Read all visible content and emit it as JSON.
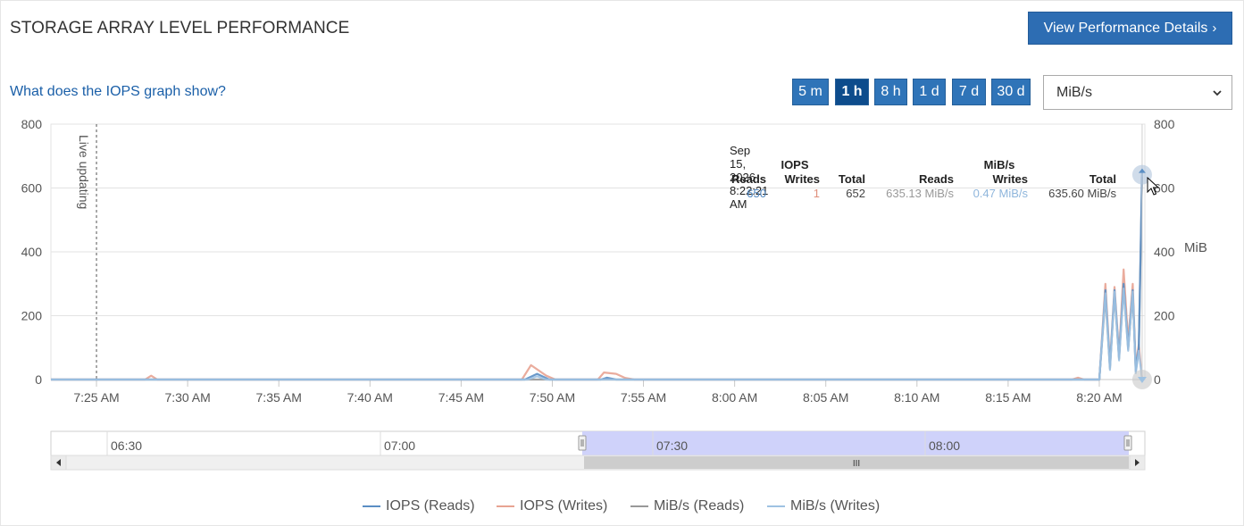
{
  "header": {
    "title": "STORAGE ARRAY LEVEL PERFORMANCE",
    "details_button": "View Performance Details",
    "details_chevron": "›"
  },
  "help_link": "What does the IOPS graph show?",
  "range_buttons": [
    "5 m",
    "1 h",
    "8 h",
    "1 d",
    "7 d",
    "30 d"
  ],
  "active_range": "1 h",
  "unit_select": {
    "value": "MiB/s"
  },
  "live_label": "Live updating",
  "tooltip": {
    "date": "Sep 15, 2026 8:22:21 AM",
    "iops_group": "IOPS",
    "mibs_group": "MiB/s",
    "headers": [
      "Reads",
      "Writes",
      "Total",
      "Reads",
      "Writes",
      "Total"
    ],
    "values": [
      "650",
      "1",
      "652",
      "635.13 MiB/s",
      "0.47 MiB/s",
      "635.60 MiB/s"
    ]
  },
  "right_axis_title": "MiB",
  "navigator": {
    "labels": [
      "06:30",
      "07:00",
      "07:30",
      "08:00"
    ],
    "scroll_grip": "III"
  },
  "legend": [
    {
      "name": "IOPS (Reads)",
      "color": "#5b8ec4"
    },
    {
      "name": "IOPS (Writes)",
      "color": "#e8a392"
    },
    {
      "name": "MiB/s (Reads)",
      "color": "#999999"
    },
    {
      "name": "MiB/s (Writes)",
      "color": "#9fc2e2"
    }
  ],
  "colors": {
    "accent": "#2d6db3",
    "active_range": "#0d4c8c",
    "navigator_selection": "#ccd0fa"
  },
  "chart_data": {
    "type": "line",
    "x_unit": "time",
    "x_ticks": [
      "7:25 AM",
      "7:30 AM",
      "7:35 AM",
      "7:40 AM",
      "7:45 AM",
      "7:50 AM",
      "7:55 AM",
      "8:00 AM",
      "8:05 AM",
      "8:10 AM",
      "8:15 AM",
      "8:20 AM"
    ],
    "x_range": [
      "7:22:30 AM",
      "8:22:30 AM"
    ],
    "y_left": {
      "ticks": [
        0,
        200,
        400,
        600,
        800
      ],
      "ylim": [
        0,
        800
      ]
    },
    "y_right": {
      "label": "MiB",
      "ticks": [
        0,
        200,
        400,
        600,
        800
      ],
      "ylim": [
        0,
        800
      ]
    },
    "grid": true,
    "legend_position": "bottom",
    "series": [
      {
        "name": "IOPS (Reads)",
        "points": [
          [
            "7:22:30",
            0
          ],
          [
            "7:48:30",
            0
          ],
          [
            "7:49:10",
            18
          ],
          [
            "7:49:50",
            0
          ],
          [
            "7:52:40",
            0
          ],
          [
            "7:53:00",
            6
          ],
          [
            "7:53:30",
            0
          ],
          [
            "8:20:00",
            0
          ],
          [
            "8:20:20",
            280
          ],
          [
            "8:20:35",
            40
          ],
          [
            "8:20:50",
            280
          ],
          [
            "8:21:05",
            70
          ],
          [
            "8:21:20",
            300
          ],
          [
            "8:21:35",
            100
          ],
          [
            "8:21:50",
            280
          ],
          [
            "8:22:00",
            30
          ],
          [
            "8:22:10",
            100
          ],
          [
            "8:22:21",
            650
          ]
        ]
      },
      {
        "name": "IOPS (Writes)",
        "points": [
          [
            "7:22:30",
            0
          ],
          [
            "7:27:40",
            0
          ],
          [
            "7:28:00",
            12
          ],
          [
            "7:28:20",
            0
          ],
          [
            "7:48:20",
            0
          ],
          [
            "7:48:50",
            45
          ],
          [
            "7:49:40",
            12
          ],
          [
            "7:50:10",
            0
          ],
          [
            "7:52:30",
            0
          ],
          [
            "7:52:50",
            22
          ],
          [
            "7:53:30",
            18
          ],
          [
            "7:54:00",
            5
          ],
          [
            "7:54:30",
            0
          ],
          [
            "8:18:30",
            0
          ],
          [
            "8:18:50",
            6
          ],
          [
            "8:19:10",
            0
          ],
          [
            "8:20:00",
            0
          ],
          [
            "8:20:20",
            300
          ],
          [
            "8:20:35",
            50
          ],
          [
            "8:20:50",
            290
          ],
          [
            "8:21:05",
            80
          ],
          [
            "8:21:20",
            345
          ],
          [
            "8:21:35",
            120
          ],
          [
            "8:21:50",
            300
          ],
          [
            "8:22:00",
            40
          ],
          [
            "8:22:10",
            110
          ],
          [
            "8:22:21",
            1
          ]
        ]
      },
      {
        "name": "MiB/s (Reads)",
        "points": [
          [
            "7:22:30",
            0
          ],
          [
            "8:20:00",
            0
          ],
          [
            "8:20:20",
            260
          ],
          [
            "8:20:35",
            35
          ],
          [
            "8:20:50",
            270
          ],
          [
            "8:21:05",
            65
          ],
          [
            "8:21:20",
            290
          ],
          [
            "8:21:35",
            95
          ],
          [
            "8:21:50",
            270
          ],
          [
            "8:22:00",
            25
          ],
          [
            "8:22:10",
            95
          ],
          [
            "8:22:21",
            635.13
          ]
        ]
      },
      {
        "name": "MiB/s (Writes)",
        "points": [
          [
            "7:22:30",
            0
          ],
          [
            "7:48:40",
            0
          ],
          [
            "7:49:10",
            10
          ],
          [
            "7:49:40",
            0
          ],
          [
            "8:20:00",
            0
          ],
          [
            "8:20:20",
            270
          ],
          [
            "8:20:35",
            30
          ],
          [
            "8:20:50",
            275
          ],
          [
            "8:21:05",
            60
          ],
          [
            "8:21:20",
            285
          ],
          [
            "8:21:35",
            90
          ],
          [
            "8:21:50",
            275
          ],
          [
            "8:22:00",
            20
          ],
          [
            "8:22:10",
            90
          ],
          [
            "8:22:21",
            0.47
          ]
        ]
      }
    ]
  }
}
